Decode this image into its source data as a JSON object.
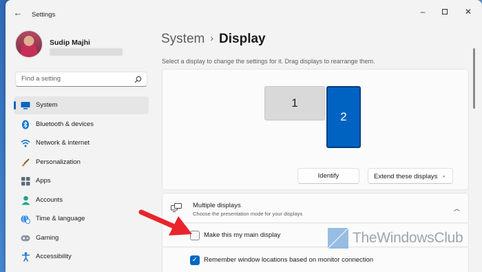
{
  "window": {
    "title": "Settings"
  },
  "profile": {
    "name": "Sudip Majhi"
  },
  "search": {
    "placeholder": "Find a setting"
  },
  "sidebar": {
    "items": [
      {
        "label": "System",
        "icon": "system-icon",
        "active": true
      },
      {
        "label": "Bluetooth & devices",
        "icon": "bluetooth-icon"
      },
      {
        "label": "Network & internet",
        "icon": "wifi-icon"
      },
      {
        "label": "Personalization",
        "icon": "brush-icon"
      },
      {
        "label": "Apps",
        "icon": "apps-icon"
      },
      {
        "label": "Accounts",
        "icon": "person-icon"
      },
      {
        "label": "Time & language",
        "icon": "globe-clock-icon"
      },
      {
        "label": "Gaming",
        "icon": "gamepad-icon"
      },
      {
        "label": "Accessibility",
        "icon": "accessibility-icon"
      }
    ]
  },
  "breadcrumb": {
    "parent": "System",
    "separator": "›",
    "current": "Display"
  },
  "main": {
    "description": "Select a display to change the settings for it. Drag displays to rearrange them.",
    "monitors": [
      {
        "label": "1"
      },
      {
        "label": "2",
        "selected": true
      }
    ],
    "identify_label": "Identify",
    "mode_select": {
      "value": "Extend these displays"
    }
  },
  "multiple_displays": {
    "title": "Multiple displays",
    "subtitle": "Choose the presentation mode for your displays",
    "options": [
      {
        "label": "Make this my main display",
        "checked": false
      },
      {
        "label": "Remember window locations based on monitor connection",
        "checked": true
      }
    ]
  },
  "watermark": {
    "text": "TheWindowsClub"
  },
  "colors": {
    "accent": "#0067c0",
    "selected_monitor": "#0063c1",
    "annotation_arrow": "#e8252b"
  }
}
